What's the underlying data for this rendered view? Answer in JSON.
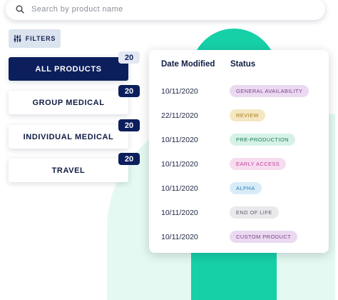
{
  "search": {
    "placeholder": "Search by product name",
    "icon": "search-icon"
  },
  "filters": {
    "label": "FILTERS",
    "icon": "sliders-icon"
  },
  "categories": [
    {
      "label": "ALL PRODUCTS",
      "count": "20",
      "active": true
    },
    {
      "label": "GROUP MEDICAL",
      "count": "20",
      "active": false
    },
    {
      "label": "INDIVIDUAL MEDICAL",
      "count": "20",
      "active": false
    },
    {
      "label": "TRAVEL",
      "count": "20",
      "active": false
    }
  ],
  "table": {
    "headers": {
      "date": "Date Modified",
      "status": "Status"
    },
    "rows": [
      {
        "date": "10/11/2020",
        "status": "GENERAL AVAILABILITY",
        "bg": "#ead9f0",
        "fg": "#7b3f8c"
      },
      {
        "date": "22/11/2020",
        "status": "REVIEW",
        "bg": "#f4e7c2",
        "fg": "#a87d12"
      },
      {
        "date": "10/11/2020",
        "status": "PRE-PRODUCTION",
        "bg": "#d6f2e6",
        "fg": "#1c7a56"
      },
      {
        "date": "10/11/2020",
        "status": "EARLY ACCESS",
        "bg": "#f7dcef",
        "fg": "#c2449b"
      },
      {
        "date": "10/11/2020",
        "status": "ALPHA",
        "bg": "#d8ecf8",
        "fg": "#2a7fb8"
      },
      {
        "date": "10/11/2020",
        "status": "END OF LIFE",
        "bg": "#e9e9ec",
        "fg": "#5b5f6b"
      },
      {
        "date": "10/11/2020",
        "status": "CUSTOM PRODUCT",
        "bg": "#ead9f0",
        "fg": "#7b3f8c"
      }
    ]
  },
  "colors": {
    "navy": "#0c1f5c",
    "teal": "#16d0a8",
    "mint": "#e4f9f1"
  }
}
